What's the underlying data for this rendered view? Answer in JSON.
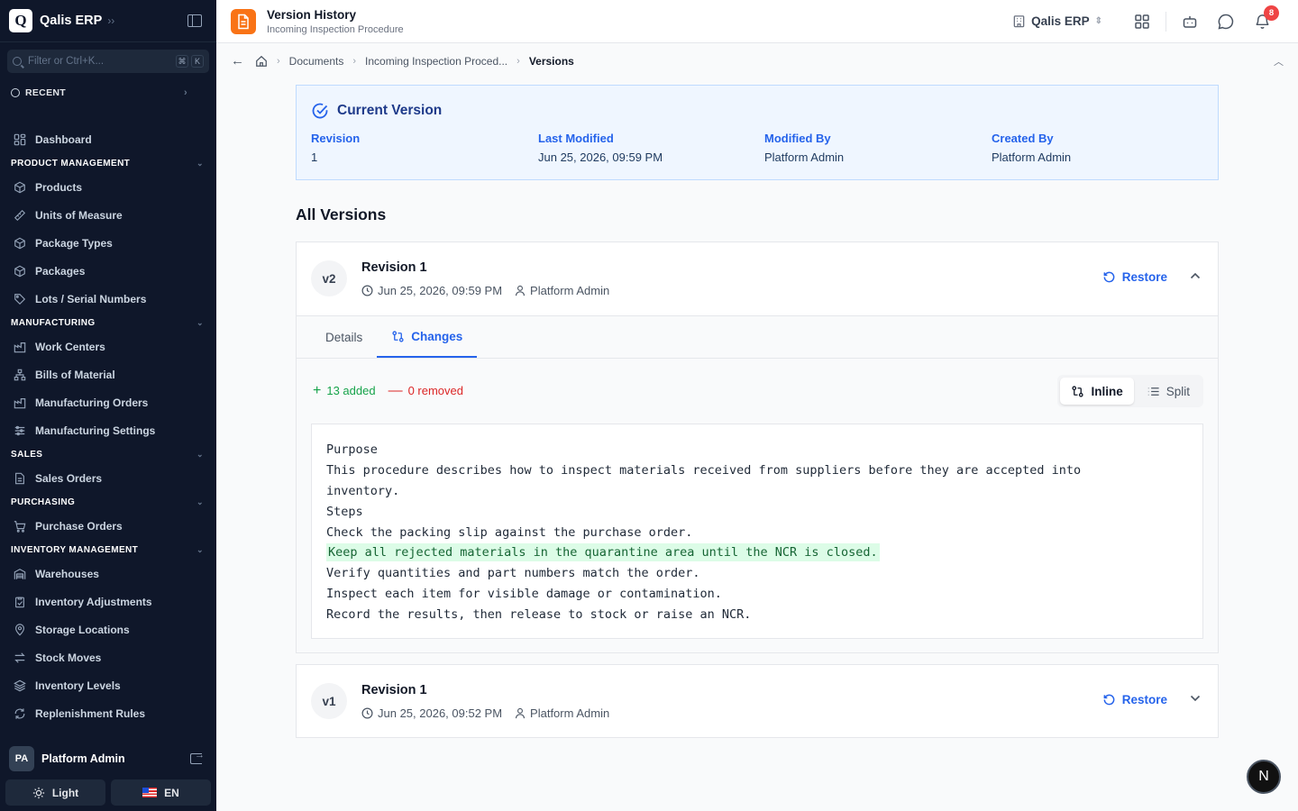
{
  "sidebar": {
    "brand": "Qalis ERP",
    "brand_logo": "Q",
    "search_placeholder": "Filter or Ctrl+K...",
    "search_keys": [
      "⌘",
      "K"
    ],
    "recent_label": "RECENT",
    "dashboard": "Dashboard",
    "sections": [
      {
        "title": "PRODUCT MANAGEMENT",
        "items": [
          {
            "label": "Products",
            "icon": "cube-icon"
          },
          {
            "label": "Units of Measure",
            "icon": "ruler-icon"
          },
          {
            "label": "Package Types",
            "icon": "cube-icon"
          },
          {
            "label": "Packages",
            "icon": "cube-icon"
          },
          {
            "label": "Lots / Serial Numbers",
            "icon": "tag-icon"
          }
        ]
      },
      {
        "title": "MANUFACTURING",
        "items": [
          {
            "label": "Work Centers",
            "icon": "factory-icon"
          },
          {
            "label": "Bills of Material",
            "icon": "network-icon"
          },
          {
            "label": "Manufacturing Orders",
            "icon": "factory-icon"
          },
          {
            "label": "Manufacturing Settings",
            "icon": "sliders-icon"
          }
        ]
      },
      {
        "title": "SALES",
        "items": [
          {
            "label": "Sales Orders",
            "icon": "document-icon"
          }
        ]
      },
      {
        "title": "PURCHASING",
        "items": [
          {
            "label": "Purchase Orders",
            "icon": "cart-icon"
          }
        ]
      },
      {
        "title": "INVENTORY MANAGEMENT",
        "items": [
          {
            "label": "Warehouses",
            "icon": "warehouse-icon"
          },
          {
            "label": "Inventory Adjustments",
            "icon": "clipboard-check-icon"
          },
          {
            "label": "Storage Locations",
            "icon": "map-pin-icon"
          },
          {
            "label": "Stock Moves",
            "icon": "arrows-icon"
          },
          {
            "label": "Inventory Levels",
            "icon": "layers-icon"
          },
          {
            "label": "Replenishment Rules",
            "icon": "refresh-icon"
          }
        ]
      }
    ],
    "user_initials": "PA",
    "user_name": "Platform Admin",
    "theme_label": "Light",
    "lang_label": "EN"
  },
  "header": {
    "title": "Version History",
    "subtitle": "Incoming Inspection Procedure",
    "company": "Qalis ERP",
    "notification_count": "8"
  },
  "breadcrumb": {
    "items": [
      "Documents",
      "Incoming Inspection Proced...",
      "Versions"
    ]
  },
  "current_version": {
    "heading": "Current Version",
    "fields": [
      {
        "label": "Revision",
        "value": "1"
      },
      {
        "label": "Last Modified",
        "value": "Jun 25, 2026, 09:59 PM"
      },
      {
        "label": "Modified By",
        "value": "Platform Admin"
      },
      {
        "label": "Created By",
        "value": "Platform Admin"
      }
    ]
  },
  "all_versions_title": "All Versions",
  "versions": [
    {
      "badge": "v2",
      "title": "Revision 1",
      "date": "Jun 25, 2026, 09:59 PM",
      "author": "Platform Admin",
      "restore_label": "Restore",
      "tabs": [
        "Details",
        "Changes"
      ],
      "added_label": "13 added",
      "removed_label": "0 removed",
      "view_modes": [
        "Inline",
        "Split"
      ],
      "diff_lines": [
        {
          "text": "Purpose",
          "type": "same"
        },
        {
          "text": "This procedure describes how to inspect materials received from suppliers before they are accepted into",
          "type": "same"
        },
        {
          "text": "inventory.",
          "type": "same"
        },
        {
          "text": "Steps",
          "type": "same"
        },
        {
          "text": "Check the packing slip against the purchase order.",
          "type": "same"
        },
        {
          "text": "Keep all rejected materials in the quarantine area until the NCR is closed.",
          "type": "added"
        },
        {
          "text": "Verify quantities and part numbers match the order.",
          "type": "same"
        },
        {
          "text": "Inspect each item for visible damage or contamination.",
          "type": "same"
        },
        {
          "text": "Record the results, then release to stock or raise an NCR.",
          "type": "same"
        }
      ]
    },
    {
      "badge": "v1",
      "title": "Revision 1",
      "date": "Jun 25, 2026, 09:52 PM",
      "author": "Platform Admin",
      "restore_label": "Restore"
    }
  ],
  "fab_label": "N",
  "colors": {
    "sidebar_bg": "#0f172a",
    "accent": "#2563eb",
    "doc_badge": "#f97316",
    "added": "#16a34a",
    "removed": "#dc2626",
    "badge": "#ef4444"
  }
}
